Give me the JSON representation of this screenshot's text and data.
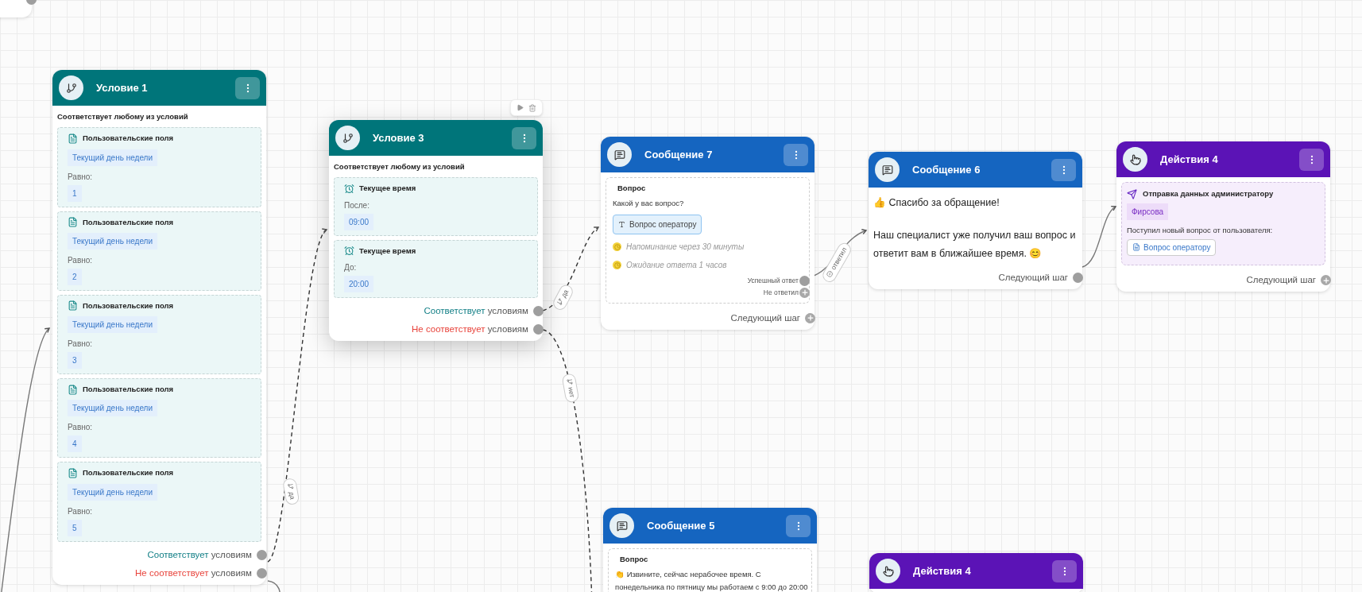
{
  "nodes": [
    {
      "kind": "condition",
      "title": "Условие 1",
      "selected": false,
      "subtitle": "Соответствует любому из условий",
      "conditions": [
        {
          "kind": "field",
          "title": "Пользовательские поля",
          "field": "Текущий день недели",
          "operator": "Равно:",
          "value": "1"
        },
        {
          "kind": "field",
          "title": "Пользовательские поля",
          "field": "Текущий день недели",
          "operator": "Равно:",
          "value": "2"
        },
        {
          "kind": "field",
          "title": "Пользовательские поля",
          "field": "Текущий день недели",
          "operator": "Равно:",
          "value": "3"
        },
        {
          "kind": "field",
          "title": "Пользовательские поля",
          "field": "Текущий день недели",
          "operator": "Равно:",
          "value": "4"
        },
        {
          "kind": "field",
          "title": "Пользовательские поля",
          "field": "Текущий день недели",
          "operator": "Равно:",
          "value": "5"
        }
      ],
      "outputs": [
        {
          "kind": "match",
          "highlight": "Соответствует",
          "rest": "условиям",
          "connected": true
        },
        {
          "kind": "nomatch",
          "highlight": "Не соответствует",
          "rest": "условиям",
          "connected": true
        }
      ]
    },
    {
      "kind": "condition",
      "title": "Условие 3",
      "selected": true,
      "subtitle": "Соответствует любому из условий",
      "conditions": [
        {
          "kind": "time",
          "title": "Текущее время",
          "operator": "После:",
          "value": "09:00"
        },
        {
          "kind": "time",
          "title": "Текущее время",
          "operator": "До:",
          "value": "20:00"
        }
      ],
      "outputs": [
        {
          "kind": "match",
          "highlight": "Соответствует",
          "rest": "условиям",
          "connected": true
        },
        {
          "kind": "nomatch",
          "highlight": "Не соответствует",
          "rest": "условиям",
          "connected": true
        }
      ]
    },
    {
      "kind": "message",
      "title": "Сообщение 7",
      "selected": false,
      "blocks": [
        {
          "title": "Вопрос",
          "text": "Какой у вас вопрос?",
          "answer": "Вопрос оператору",
          "timers": [
            "Напоминание через 30 минуты",
            "Ожидание ответа 1 часов"
          ],
          "outputs": [
            {
              "label": "Успешный ответ",
              "connected": true
            },
            {
              "label": "Не ответил",
              "connected": false
            }
          ]
        }
      ],
      "next": {
        "label": "Следующий шаг",
        "connected": false
      }
    },
    {
      "kind": "message",
      "title": "Сообщение 6",
      "selected": false,
      "paragraphs": [
        "👍 Спасибо за обращение!",
        "Наш специалист уже получил ваш вопрос и ответит вам в ближайшее время. 😊"
      ],
      "next": {
        "label": "Следующий шаг",
        "connected": true
      }
    },
    {
      "kind": "action",
      "title": "Действия 4",
      "selected": false,
      "actions": [
        {
          "title": "Отправка данных администратору",
          "recipient": "Фирсова",
          "text": "Поступил новый вопрос от пользователя:",
          "variable": "Вопрос оператору"
        }
      ],
      "next": {
        "label": "Следующий шаг",
        "connected": false
      }
    },
    {
      "kind": "message",
      "title": "Сообщение 5",
      "selected": false,
      "blocks": [
        {
          "title": "Вопрос",
          "text": "👏 Извините, сейчас нерабочее время. С понедельника по пятницу мы работаем с 9:00 до 20:00"
        }
      ]
    },
    {
      "kind": "action",
      "title": "Действия 4",
      "selected": false
    }
  ],
  "edge_labels": [
    {
      "kind": "branch",
      "text": "да"
    },
    {
      "kind": "branch",
      "text": "да"
    },
    {
      "kind": "branch",
      "text": "нет"
    },
    {
      "kind": "answer",
      "text": "ответил"
    }
  ]
}
